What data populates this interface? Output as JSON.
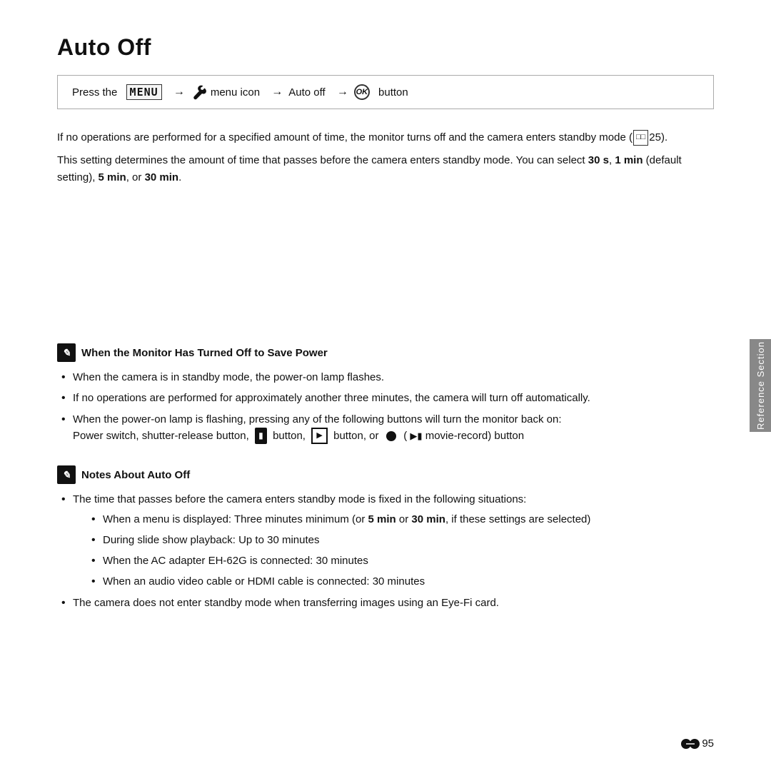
{
  "page": {
    "title": "Auto Off",
    "nav": {
      "prefix": "Press the",
      "menu_word": "MENU",
      "button_label": "button",
      "arrow1": "→",
      "wrench_symbol": "⚙",
      "menu_icon_label": "menu icon",
      "arrow2": "→",
      "auto_off_label": "Auto off",
      "arrow3": "→",
      "ok_label": "OK",
      "suffix": "button"
    },
    "description1": "If no operations are performed for a specified amount of time, the monitor turns off and the camera enters standby mode (",
    "page_ref": "25",
    "description1_end": ").",
    "description2_prefix": "This setting determines the amount of time that passes before the camera enters standby mode. You can select ",
    "bold_30s": "30 s",
    "comma1": ", ",
    "bold_1min": "1 min",
    "desc_default": " (default setting), ",
    "bold_5min": "5 min",
    "desc_or": ", or ",
    "bold_30min": "30 min",
    "desc_end": ".",
    "note_section1": {
      "heading": "When the Monitor Has Turned Off to Save Power",
      "bullets": [
        "When the camera is in standby mode, the power-on lamp flashes.",
        "If no operations are performed for approximately another three minutes, the camera will turn off automatically.",
        "When the power-on lamp is flashing, pressing any of the following buttons will turn the monitor back on:"
      ],
      "power_line": "Power switch, shutter-release button,",
      "power_line2": "button,",
      "power_line3": "button, or",
      "power_line4": "(",
      "power_line5": "movie-record) button"
    },
    "note_section2": {
      "heading": "Notes About Auto Off",
      "bullet1": "The time that passes before the camera enters standby mode is fixed in the following situations:",
      "sub_bullets": [
        {
          "text_prefix": "When a menu is displayed: Three minutes minimum (or ",
          "bold1": "5 min",
          "text_mid": " or ",
          "bold2": "30 min",
          "text_end": ", if these settings are selected)"
        },
        {
          "text": "During slide show playback: Up to 30 minutes"
        },
        {
          "text": "When the AC adapter EH-62G is connected: 30 minutes"
        },
        {
          "text": "When an audio video cable or HDMI cable is connected: 30 minutes"
        }
      ],
      "bullet2": "The camera does not enter standby mode when transferring images using an Eye-Fi card."
    },
    "sidebar_label": "Reference Section",
    "page_number": "95"
  }
}
